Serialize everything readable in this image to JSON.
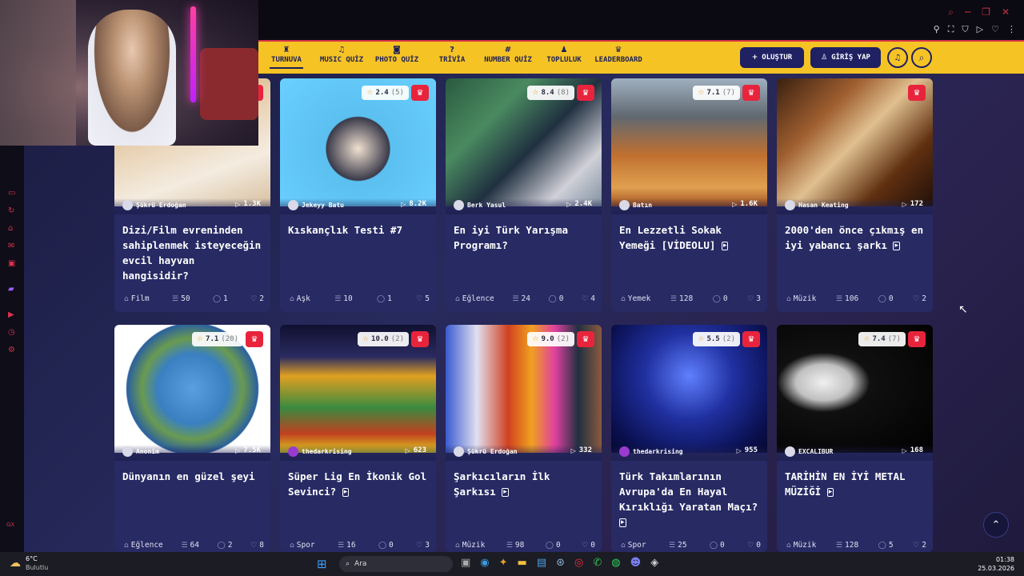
{
  "browser": {
    "window_controls": [
      "⌕",
      "─",
      "❐",
      "✕"
    ],
    "extension_icons": [
      "⚲",
      "⛶",
      "⛉",
      "▷",
      "♡",
      "⋮"
    ]
  },
  "nav": {
    "items": [
      {
        "label": "TURNUVA",
        "icon": "♜"
      },
      {
        "label": "MUSIC QUİZ",
        "icon": "♫"
      },
      {
        "label": "PHOTO QUİZ",
        "icon": "◙"
      },
      {
        "label": "TRİVİA",
        "icon": "?"
      },
      {
        "label": "NUMBER QUİZ",
        "icon": "#"
      },
      {
        "label": "TOPLULUK",
        "icon": "♟"
      },
      {
        "label": "LEADERBOARD",
        "icon": "♛"
      }
    ],
    "create_label": "OLUŞTUR",
    "login_label": "GİRİŞ YAP",
    "bell_icon": "🔔",
    "search_icon": "⌕"
  },
  "cards": [
    {
      "rating": "",
      "rating_count": "",
      "author": "Şükrü Erdoğan",
      "plays": "1.3K",
      "title": "Dizi/Film evreninden sahiplenmek isteyeceğin evcil hayvan hangisidir?",
      "video": false,
      "category": "Film",
      "questions": "50",
      "comments": "1",
      "likes": "2",
      "thumb": "linear-gradient(160deg,#c8a070 0%,#e8d0b0 40%,#f4ece0 70%,#d8c0a0 100%)"
    },
    {
      "rating": "2.4",
      "rating_count": "(5)",
      "author": "Jekeyy Batu",
      "plays": "8.2K",
      "title": "Kıskançlık Testi #7",
      "video": false,
      "category": "Aşk",
      "questions": "10",
      "comments": "1",
      "likes": "5",
      "thumb": "radial-gradient(circle at 50% 55%,#f0e0d0 0%,#3a3a4a 30%,#5bc0f0 31%,#6ad0ff 100%)"
    },
    {
      "rating": "8.4",
      "rating_count": "(8)",
      "author": "Berk Yasul",
      "plays": "2.4K",
      "title": "En iyi Türk Yarışma Programı?",
      "video": false,
      "category": "Eğlence",
      "questions": "24",
      "comments": "0",
      "likes": "4",
      "thumb": "linear-gradient(135deg,#2a5a40 0%,#4a8a60 30%,#203040 55%,#d0d0d8 80%,#8090a0 100%)"
    },
    {
      "rating": "7.1",
      "rating_count": "(7)",
      "author": "Batın",
      "plays": "1.6K",
      "title": "En Lezzetli Sokak Yemeği [VİDEOLU]",
      "video": true,
      "category": "Yemek",
      "questions": "128",
      "comments": "0",
      "likes": "3",
      "thumb": "linear-gradient(180deg,#a0b0c0 0%,#606870 30%,#c07030 60%,#e0a050 85%,#a05020 100%)"
    },
    {
      "rating": "",
      "rating_count": "",
      "author": "Hasan Keating",
      "plays": "172",
      "title": "2000'den önce çıkmış en iyi yabancı şarkı",
      "video": true,
      "category": "Müzik",
      "questions": "106",
      "comments": "0",
      "likes": "2",
      "thumb": "linear-gradient(135deg,#3a2010 0%,#a06030 30%,#e0c090 50%,#603010 75%,#201008 100%)"
    },
    {
      "rating": "7.1",
      "rating_count": "(20)",
      "author": "Anonim",
      "plays": "7.5K",
      "title": "Dünyanın en güzel şeyi",
      "video": false,
      "category": "Eğlence",
      "questions": "64",
      "comments": "2",
      "likes": "8",
      "thumb": "radial-gradient(circle at 50% 50%,#5aa0e0 0%,#3a80c0 35%,#6a9a50 50%,#2a60a0 65%,#ffffff 66%,#ffffff 100%)"
    },
    {
      "rating": "10.0",
      "rating_count": "(2)",
      "author": "thedarkrising",
      "plays": "623",
      "title": "Süper Lig En İkonik Gol Sevinci?",
      "video": true,
      "category": "Spor",
      "questions": "16",
      "comments": "0",
      "likes": "3",
      "thumb": "linear-gradient(180deg,#101030 0%,#2a2a60 25%,#e0a020 40%,#3a8a40 65%,#c04020 85%,#e0d020 100%)"
    },
    {
      "rating": "9.0",
      "rating_count": "(2)",
      "author": "Şükrü Erdoğan",
      "plays": "332",
      "title": "Şarkıcıların İlk Şarkısı",
      "video": true,
      "category": "Müzik",
      "questions": "98",
      "comments": "0",
      "likes": "0",
      "thumb": "linear-gradient(90deg,#3a5ad0 0%,#e0e0f0 20%,#d04020 40%,#f0a020 55%,#e040a0 70%,#203040 85%,#8a5a40 100%)"
    },
    {
      "rating": "5.5",
      "rating_count": "(2)",
      "author": "thedarkrising",
      "plays": "955",
      "title": "Türk Takımlarının Avrupa'da En Hayal Kırıklığı Yaratan Maçı?",
      "video": true,
      "category": "Spor",
      "questions": "25",
      "comments": "0",
      "likes": "0",
      "thumb": "radial-gradient(ellipse at 50% 40%,#6080ff 0%,#2030a0 40%,#0a1050 80%,#050830 100%)"
    },
    {
      "rating": "7.4",
      "rating_count": "(7)",
      "author": "EXCALIBUR",
      "plays": "168",
      "title": "TARİHİN EN İYİ METAL MÜZİĞİ",
      "video": true,
      "category": "Müzik",
      "questions": "128",
      "comments": "5",
      "likes": "2",
      "thumb": "radial-gradient(ellipse at 30% 45%,#f0f0f0 0%,#c0c0c0 18%,#101010 30%,#000000 100%)"
    }
  ],
  "icons": {
    "play": "▷",
    "crown": "♛",
    "star": "☆",
    "category": "⌂",
    "questions": "☰",
    "comments": "◯",
    "likes": "♡",
    "scroll_top": "⌃",
    "cursor": "↖"
  },
  "taskbar": {
    "temperature": "6°C",
    "weather_desc": "Bulutlu",
    "search_label": "Ara",
    "time": "01:38",
    "date": "25.03.2026"
  },
  "left_bar": {
    "tag": "GX"
  }
}
